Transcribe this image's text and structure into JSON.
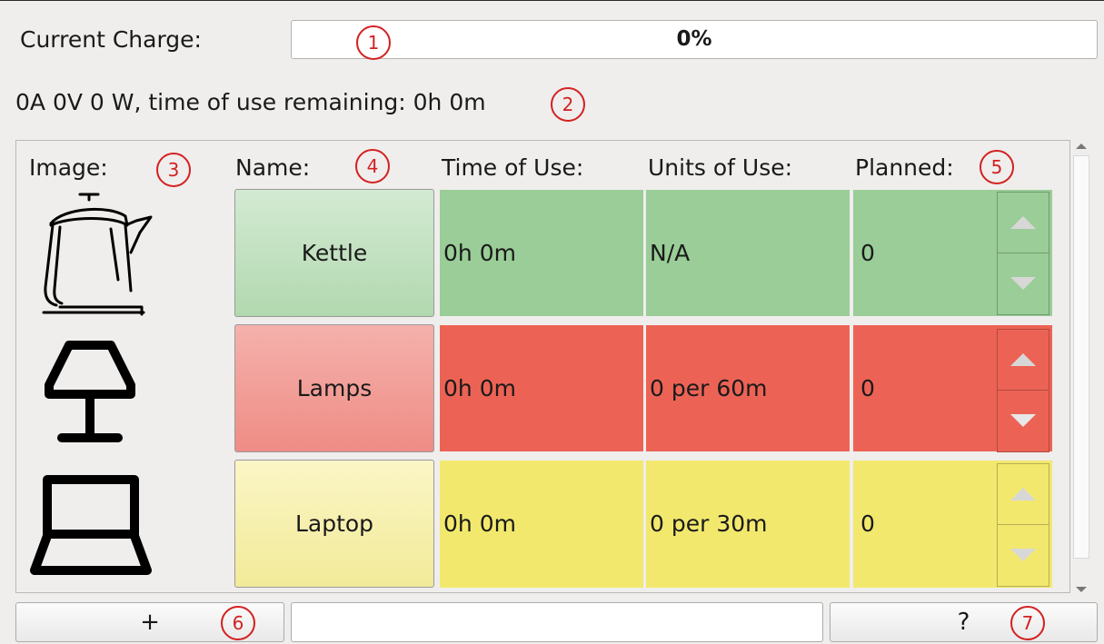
{
  "charge": {
    "label": "Current Charge:",
    "value_text": "0%",
    "fraction": 0
  },
  "status_text": "0A 0V 0 W, time of use remaining: 0h 0m",
  "columns": {
    "image": "Image:",
    "name": "Name:",
    "time_of_use": "Time of Use:",
    "units_of_use": "Units of Use:",
    "planned": "Planned:"
  },
  "appliances": [
    {
      "icon": "kettle-icon",
      "name": "Kettle",
      "time_of_use": "0h 0m",
      "units_of_use": "N/A",
      "planned": "0",
      "color": "#9acd97",
      "button_color": "#bfe0bd"
    },
    {
      "icon": "lamp-icon",
      "name": "Lamps",
      "time_of_use": "0h 0m",
      "units_of_use": "0 per 60m",
      "planned": "0",
      "color": "#ec6355",
      "button_color": "#f19e98"
    },
    {
      "icon": "laptop-icon",
      "name": "Laptop",
      "time_of_use": "0h 0m",
      "units_of_use": "0 per 30m",
      "planned": "0",
      "color": "#f2e86e",
      "button_color": "#f6f0a6"
    }
  ],
  "bottom": {
    "add_label": "+",
    "help_label": "?",
    "text_value": ""
  },
  "callouts": [
    "1",
    "2",
    "3",
    "4",
    "5",
    "6",
    "7"
  ],
  "colors": {
    "callout": "#d42020",
    "background": "#efeeed"
  }
}
